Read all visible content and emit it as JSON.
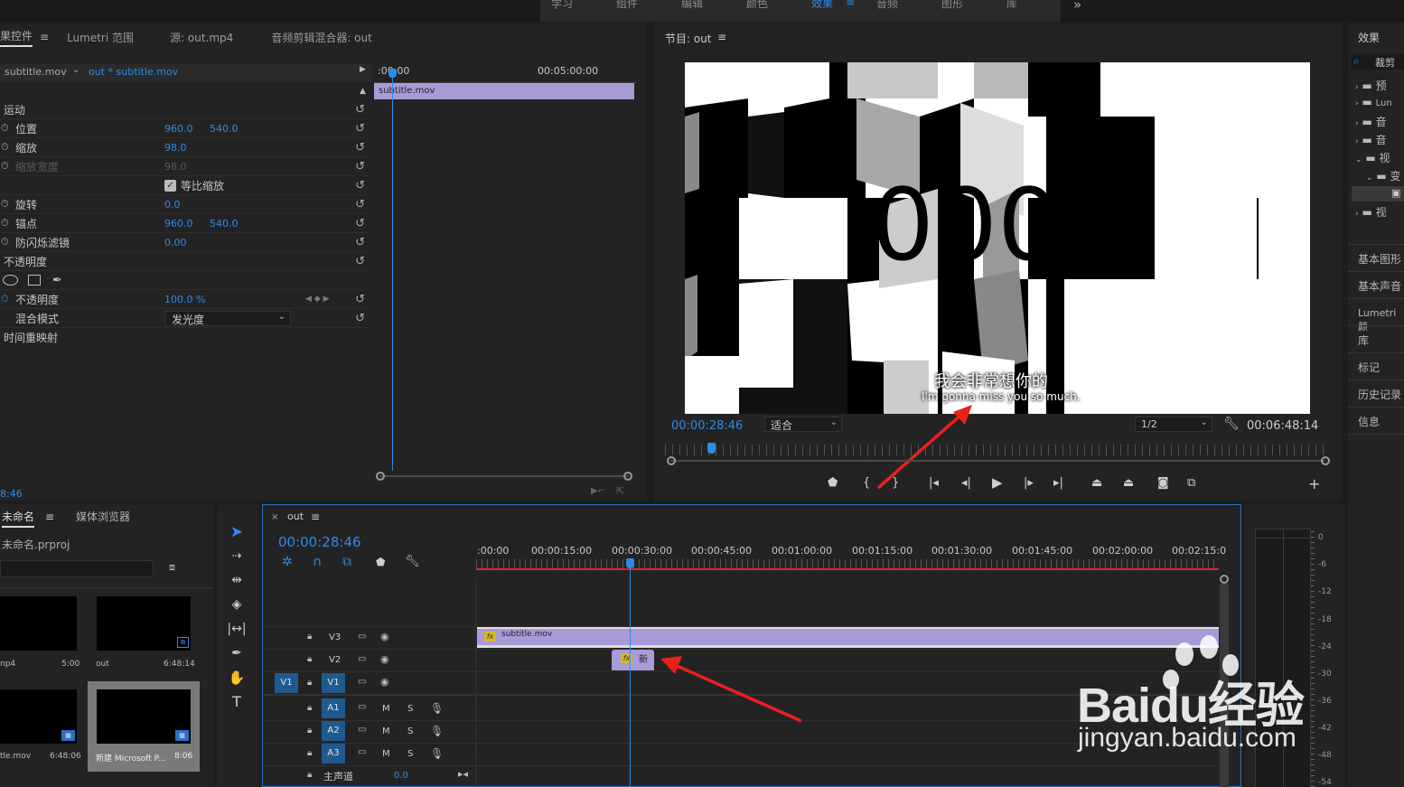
{
  "top_tabs": [
    "学习",
    "组件",
    "编辑",
    "颜色",
    "效果",
    "音频",
    "图形",
    "库"
  ],
  "more_glyph": "»",
  "effect_controls": {
    "tabs": [
      "效果控件",
      "Lumetri 范围",
      "源: out.mp4",
      "音频剪辑混合器: out"
    ],
    "source_clip": "subtitle.mov",
    "seq_clip": "out * subtitle.mov",
    "ruler_start": ":00:00",
    "ruler_mid": "00:05:00:00",
    "clip_bar": "subtitle.mov",
    "rows": {
      "motion": "运动",
      "position": {
        "label": "位置",
        "x": "960.0",
        "y": "540.0"
      },
      "scale": {
        "label": "缩放",
        "v": "98.0"
      },
      "scale_width": {
        "label": "缩放宽度",
        "v": "98.0"
      },
      "uniform": "等比缩放",
      "rotation": {
        "label": "旋转",
        "v": "0.0"
      },
      "anchor": {
        "label": "锚点",
        "x": "960.0",
        "y": "540.0"
      },
      "flicker": {
        "label": "防闪烁滤镜",
        "v": "0.00"
      },
      "opacity_group": "不透明度",
      "opacity": {
        "label": "不透明度",
        "v": "100.0 %"
      },
      "blend": {
        "label": "混合模式",
        "v": "发光度"
      },
      "remap": "时间重映射"
    },
    "timecode": "8:46"
  },
  "program": {
    "title": "节目: out",
    "subtitle_cn": "我会非常想你的",
    "subtitle_en": "I'm gonna miss you so much.",
    "timecode": "00:00:28:46",
    "fit": "适合",
    "res": "1/2",
    "duration": "00:06:48:14"
  },
  "effects_panel": {
    "title": "效果",
    "search": "裁剪",
    "tree": [
      "预",
      "Lun",
      "音",
      "音",
      "视",
      "变",
      "",
      "视"
    ],
    "sections": [
      "基本图形",
      "基本声音",
      "Lumetri 颜",
      "库",
      "标记",
      "历史记录",
      "信息"
    ]
  },
  "project": {
    "tabs": [
      "未命名",
      "媒体浏览器"
    ],
    "file": "未命名.prproj",
    "items": [
      {
        "name": "np4",
        "dur": "5:00"
      },
      {
        "name": "out",
        "dur": "6:48:14"
      },
      {
        "name": "tle.mov",
        "dur": "6:48:06"
      },
      {
        "name": "新建 Microsoft P...",
        "dur": "8:06"
      }
    ]
  },
  "timeline": {
    "tab": "out",
    "timecode": "00:00:28:46",
    "ruler": [
      ":00:00",
      "00:00:15:00",
      "00:00:30:00",
      "00:00:45:00",
      "00:01:00:00",
      "00:01:15:00",
      "00:01:30:00",
      "00:01:45:00",
      "00:02:00:00",
      "00:02:15:0"
    ],
    "video_tracks": [
      "V3",
      "V2",
      "V1"
    ],
    "audio_tracks": [
      "A1",
      "A2",
      "A3"
    ],
    "src_v": "V1",
    "master": "主声道",
    "master_val": "0.0",
    "clip_v3": "subtitle.mov",
    "clip_v2": "新",
    "m": "M",
    "s": "S"
  },
  "meter": [
    "0",
    "-6",
    "-12",
    "-18",
    "-24",
    "-30",
    "-36",
    "-42",
    "-48",
    "-54"
  ],
  "watermark": {
    "brand": "Baidu经验",
    "url": "jingyan.baidu.com"
  },
  "colors": {
    "accent": "#2d8ceb",
    "clip": "#a99ad8",
    "arrow": "#e8201c"
  }
}
